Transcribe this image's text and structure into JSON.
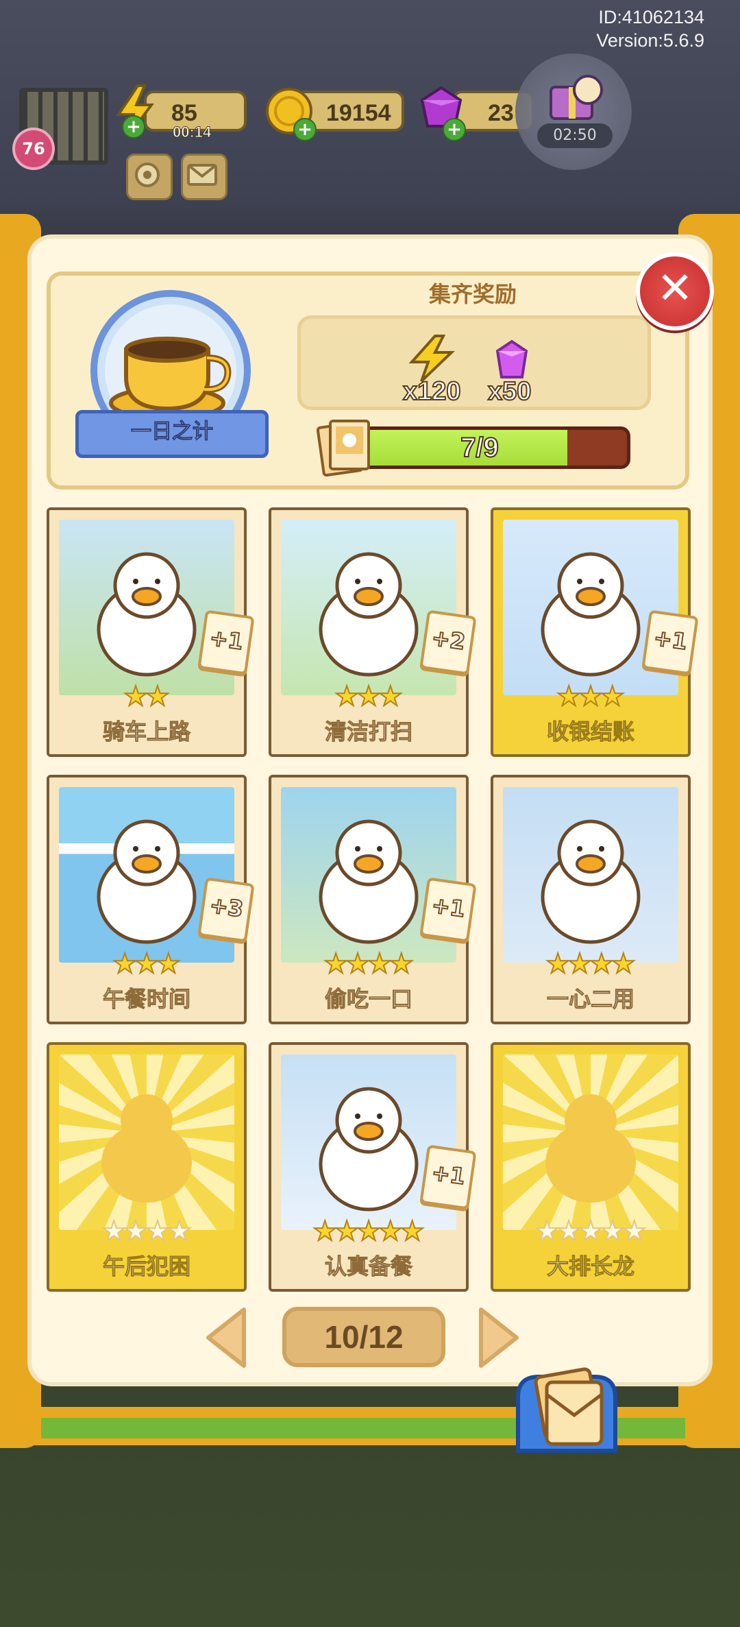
{
  "device": {
    "id_text": "ID:41062134",
    "version_text": "Version:5.6.9"
  },
  "hud": {
    "level": "76",
    "energy": {
      "value": "85",
      "timer": "00:14"
    },
    "coins": "19154",
    "gems": "23",
    "event_timer": "02:50"
  },
  "album": {
    "name": "一日之计",
    "reward_title": "集齐奖励",
    "rewards": [
      {
        "icon": "lightning-energy-icon",
        "count": "x120"
      },
      {
        "icon": "purple-gem-icon",
        "count": "x50"
      }
    ],
    "progress_text": "7/9",
    "progress": {
      "collected": 7,
      "total": 9
    }
  },
  "cards": [
    {
      "title": "骑车上路",
      "stars": 2,
      "max_stars": 2,
      "owned": true,
      "gold": false,
      "extra": "+1",
      "scene": "motorbike"
    },
    {
      "title": "清洁打扫",
      "stars": 3,
      "max_stars": 3,
      "owned": true,
      "gold": false,
      "extra": "+2",
      "scene": "sweeping"
    },
    {
      "title": "收银结账",
      "stars": 3,
      "max_stars": 3,
      "owned": true,
      "gold": true,
      "extra": "+1",
      "scene": "cashier"
    },
    {
      "title": "午餐时间",
      "stars": 3,
      "max_stars": 3,
      "owned": true,
      "gold": false,
      "extra": "+3",
      "scene": "shop"
    },
    {
      "title": "偷吃一口",
      "stars": 4,
      "max_stars": 4,
      "owned": true,
      "gold": false,
      "extra": "+1",
      "scene": "sneak-bite"
    },
    {
      "title": "一心二用",
      "stars": 4,
      "max_stars": 4,
      "owned": true,
      "gold": false,
      "extra": "",
      "scene": "laptop"
    },
    {
      "title": "午后犯困",
      "stars": 0,
      "max_stars": 4,
      "owned": false,
      "gold": true,
      "extra": "",
      "scene": "locked"
    },
    {
      "title": "认真备餐",
      "stars": 5,
      "max_stars": 5,
      "owned": true,
      "gold": false,
      "extra": "+1",
      "scene": "sandwich"
    },
    {
      "title": "大排长龙",
      "stars": 0,
      "max_stars": 5,
      "owned": false,
      "gold": true,
      "extra": "",
      "scene": "locked"
    }
  ],
  "pager": {
    "text": "10/12"
  },
  "colors": {
    "frame": "#e8a81f",
    "panel": "#fff7df",
    "progress_fill": "#a6dd3a",
    "close": "#d63e3d",
    "star": "#fbd52c"
  }
}
